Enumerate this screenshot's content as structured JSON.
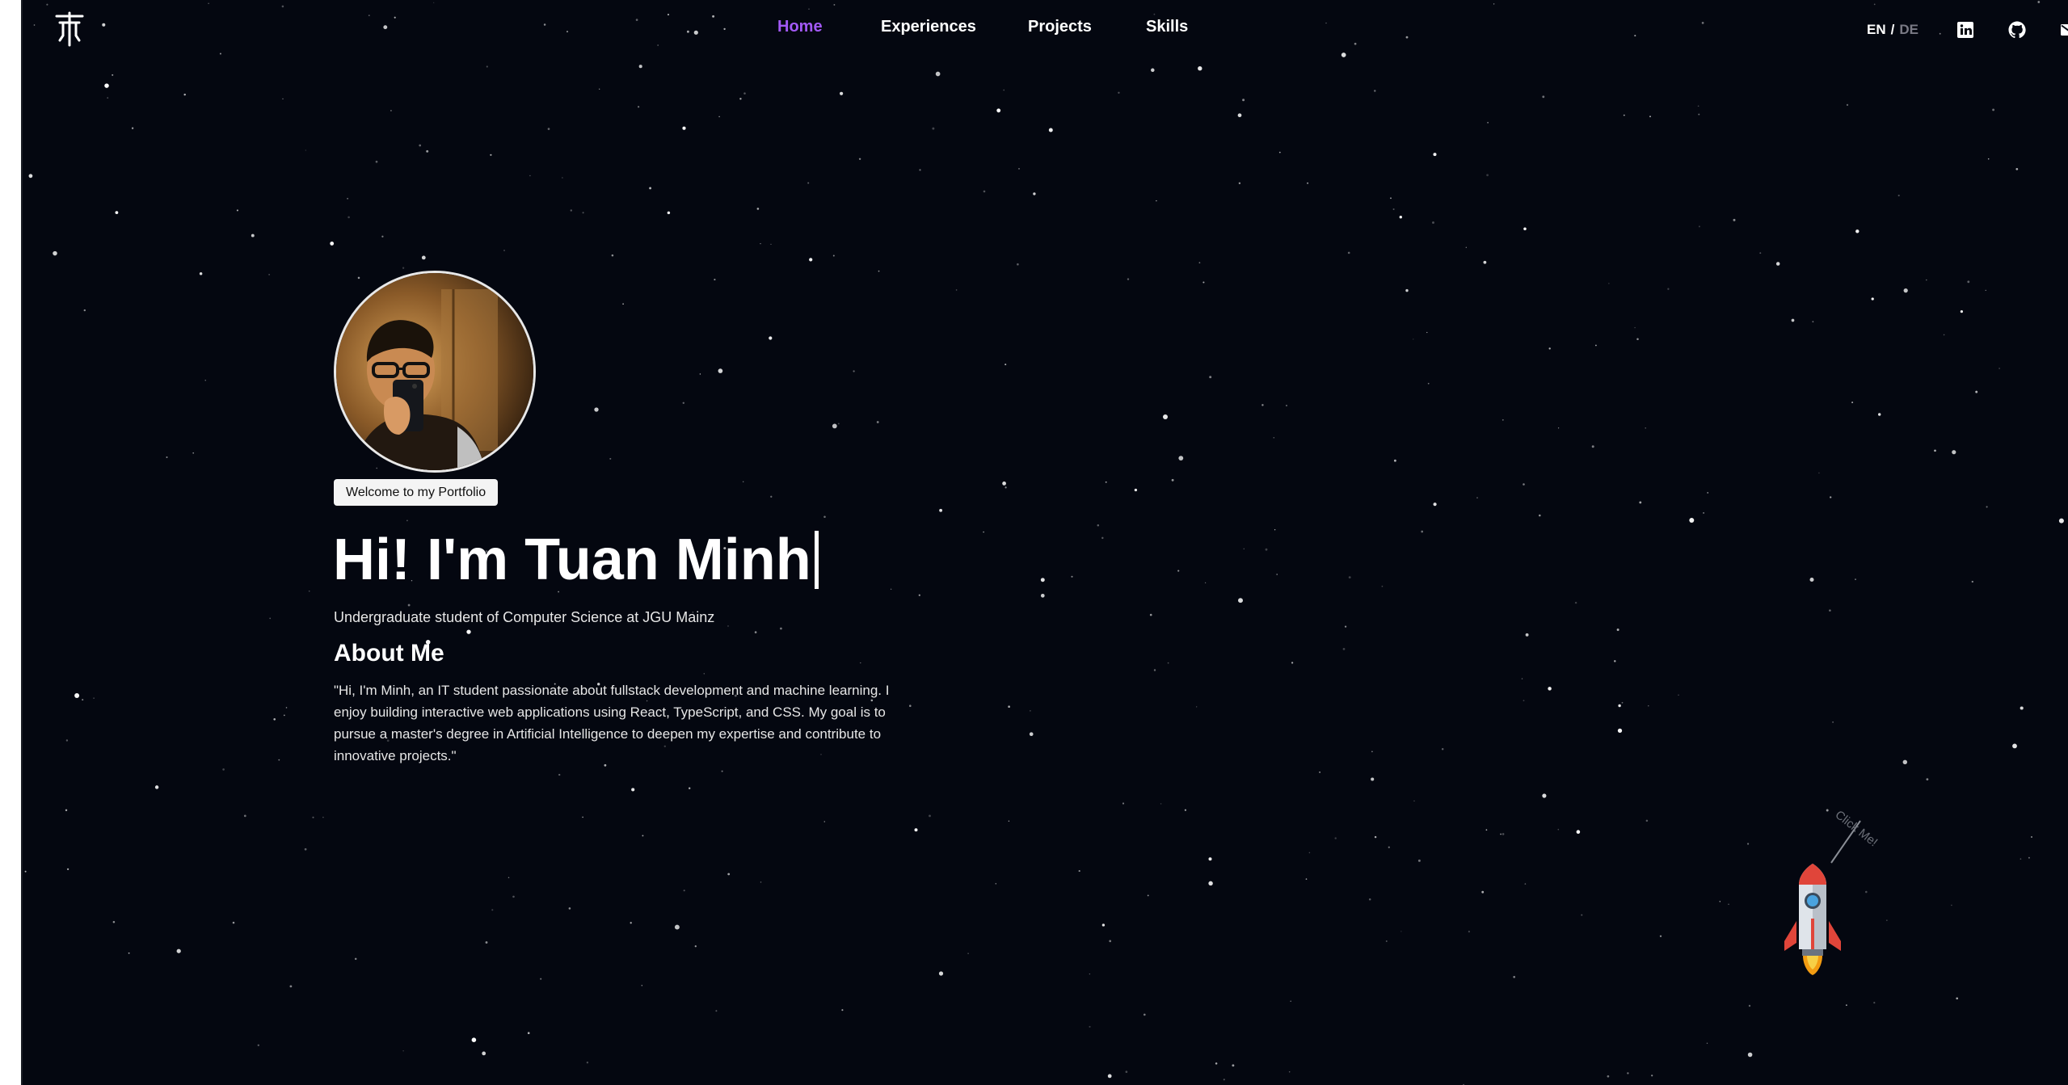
{
  "header": {
    "logo_icon": "trident-logo-icon",
    "nav": [
      {
        "label": "Home",
        "active": true
      },
      {
        "label": "Experiences",
        "active": false
      },
      {
        "label": "Projects",
        "active": false
      },
      {
        "label": "Skills",
        "active": false
      }
    ],
    "language": {
      "current": "EN",
      "separator": "/",
      "other": "DE"
    },
    "social_icons": [
      "linkedin-icon",
      "github-icon",
      "mail-icon"
    ]
  },
  "hero": {
    "avatar": "profile-photo",
    "badge": "Welcome to my Portfolio",
    "title": "Hi! I'm Tuan Minh",
    "subtitle": "Undergraduate student of Computer Science at JGU Mainz"
  },
  "about": {
    "heading": "About Me",
    "text": "\"Hi, I'm Minh, an IT student passionate about fullstack development and machine learning. I enjoy building interactive web applications using React, TypeScript, and CSS. My goal is to pursue a master's degree in Artificial Intelligence to deepen my expertise and contribute to innovative projects.\""
  },
  "rocket": {
    "icon": "rocket-icon",
    "hint": "Click Me!"
  },
  "colors": {
    "background": "#040710",
    "accent": "#a259f5",
    "text": "#ffffff"
  }
}
